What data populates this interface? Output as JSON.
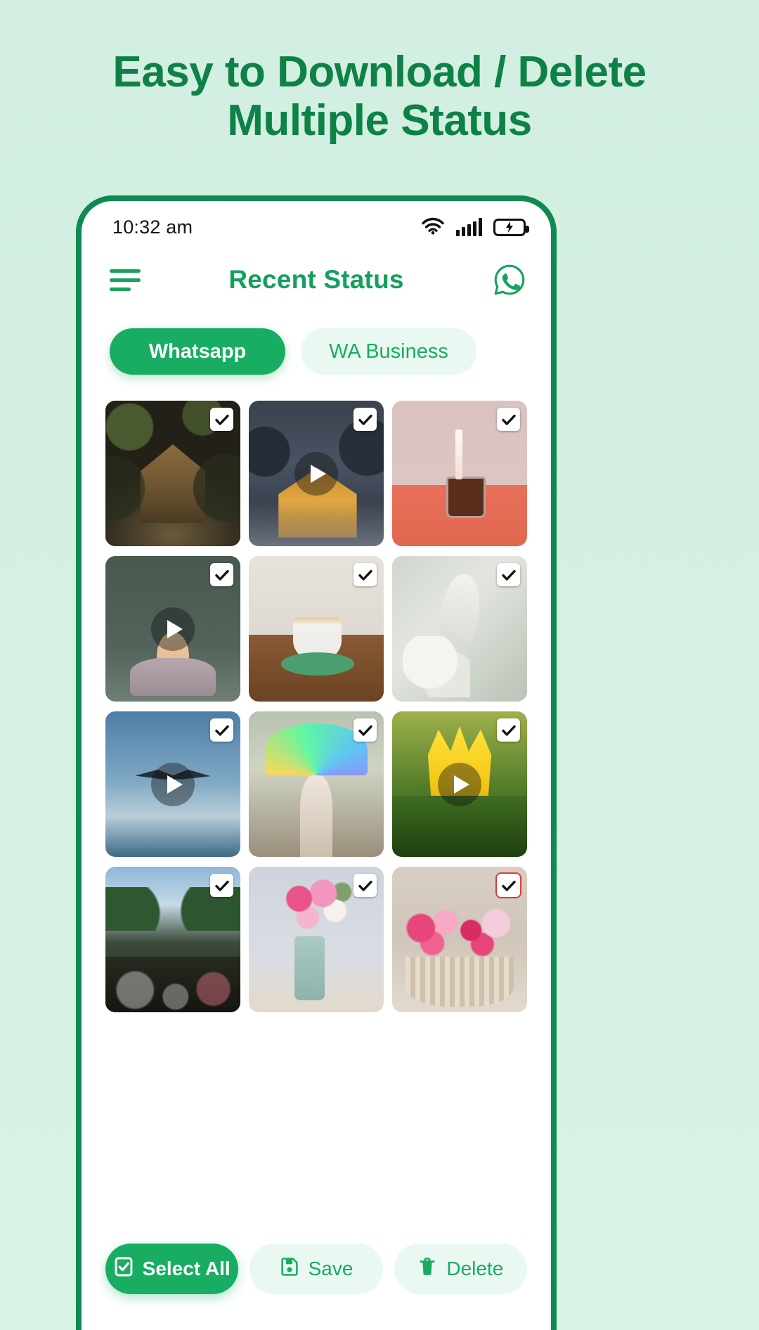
{
  "promo": {
    "line1": "Easy to Download / Delete",
    "line2": "Multiple Status",
    "color": "#0e8146"
  },
  "theme": {
    "page_background": "#d3f0e2",
    "brand_green": "#18ad62",
    "title_green": "#14a05c",
    "pill_light": "#e9f8f0",
    "frame_green": "#0f8a50"
  },
  "phone": {
    "statusbar": {
      "time": "10:32 am",
      "icons": [
        "wifi-icon",
        "signal-bars-icon",
        "battery-charging-icon"
      ]
    },
    "appbar": {
      "menu_icon": "hamburger-menu-icon",
      "title": "Recent Status",
      "action_icon": "whatsapp-icon"
    },
    "tabs": [
      {
        "label": "Whatsapp",
        "active": true
      },
      {
        "label": "WA Business",
        "active": false
      }
    ],
    "grid": {
      "columns": 3,
      "items": [
        {
          "id": 1,
          "art": "t-cabin-day",
          "checked": true,
          "type": "image",
          "alt": "Wooden cabin in forest"
        },
        {
          "id": 2,
          "art": "t-cabin-night",
          "checked": true,
          "type": "video",
          "alt": "Lit cabin in snow at night"
        },
        {
          "id": 3,
          "art": "t-coffee-pour",
          "checked": true,
          "type": "image",
          "alt": "Milk poured into coffee glass"
        },
        {
          "id": 4,
          "art": "t-duck",
          "checked": true,
          "type": "video",
          "alt": "Duckling on cloth"
        },
        {
          "id": 5,
          "art": "t-latte",
          "checked": true,
          "type": "image",
          "alt": "Latte art cup on wooden table"
        },
        {
          "id": 6,
          "art": "t-magnolia",
          "checked": true,
          "type": "image",
          "alt": "White magnolia bud"
        },
        {
          "id": 7,
          "art": "t-bird",
          "checked": true,
          "type": "video",
          "alt": "Bird flying over water"
        },
        {
          "id": 8,
          "art": "t-umbrella",
          "checked": true,
          "type": "image",
          "alt": "Colorful umbrella with powder"
        },
        {
          "id": 9,
          "art": "t-tulip",
          "checked": true,
          "type": "video",
          "alt": "Yellow tulips"
        },
        {
          "id": 10,
          "art": "t-canal",
          "checked": true,
          "type": "image",
          "alt": "Canal with bicycles"
        },
        {
          "id": 11,
          "art": "t-vase",
          "checked": true,
          "type": "image",
          "alt": "Pink flower bouquet in vase"
        },
        {
          "id": 12,
          "art": "t-basket",
          "checked": true,
          "type": "image",
          "alt": "Basket of pink carnations"
        }
      ]
    },
    "bottom_actions": [
      {
        "label": "Select All",
        "icon": "checkbox-icon",
        "style": "primary"
      },
      {
        "label": "Save",
        "icon": "save-icon",
        "style": "ghost"
      },
      {
        "label": "Delete",
        "icon": "trash-icon",
        "style": "ghost"
      }
    ]
  }
}
